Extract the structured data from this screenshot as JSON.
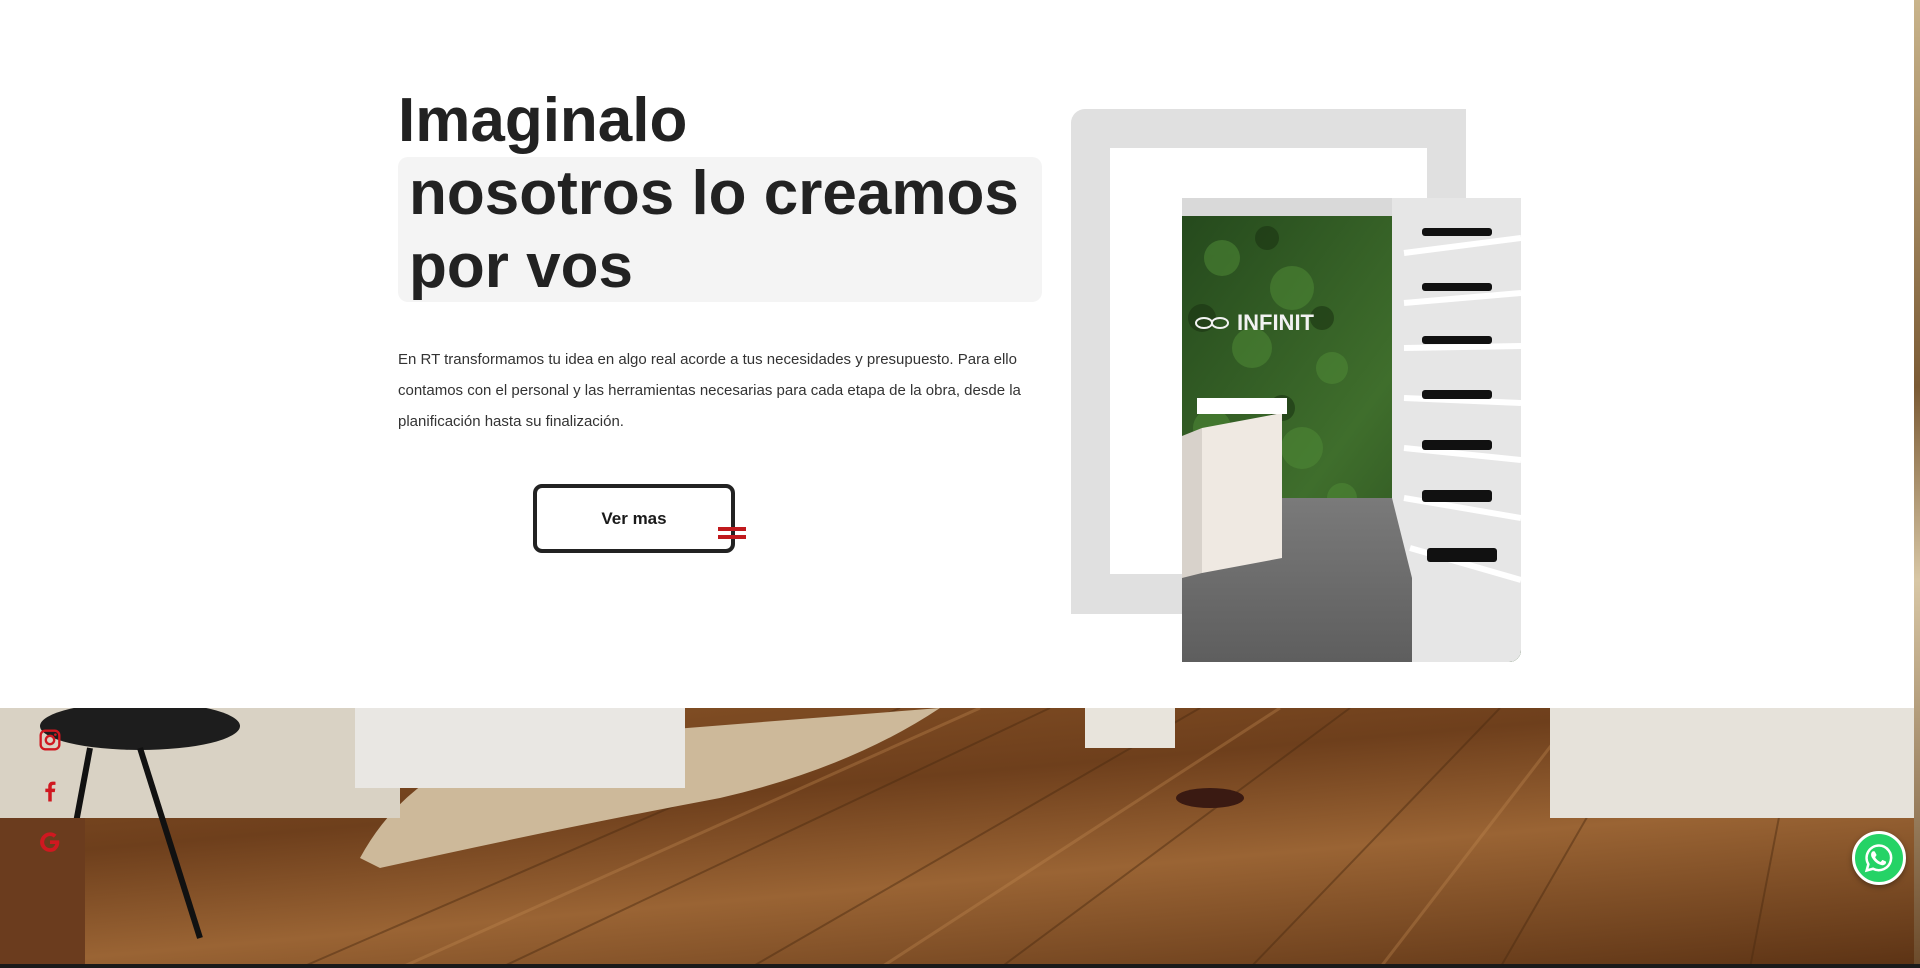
{
  "hero": {
    "headline": {
      "line1": "Imaginalo",
      "line2": "nosotros lo creamos",
      "line3": "por vos"
    },
    "intro": "En RT transformamos tu idea en algo real acorde a tus necesidades y presupuesto. Para ello contamos con el personal y las herramientas necesarias para cada etapa de la obra, desde la planificación hasta su finalización.",
    "cta_label": "Ver mas",
    "photo_sign": "INFINIT"
  },
  "social": {
    "items": [
      {
        "icon": "instagram-icon"
      },
      {
        "icon": "facebook-icon"
      },
      {
        "icon": "google-icon"
      }
    ]
  },
  "whatsapp": {
    "icon": "whatsapp-icon"
  },
  "colors": {
    "accent": "#c0191d",
    "text": "#222222",
    "frame": "#e0e0e0",
    "whatsapp": "#25d366"
  }
}
